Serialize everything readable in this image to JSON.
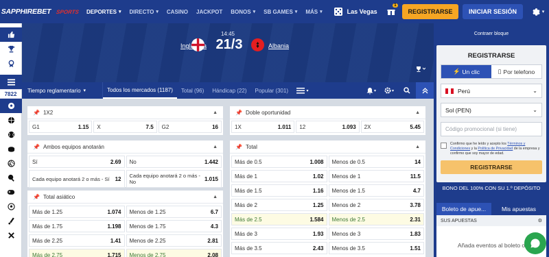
{
  "brand": {
    "name": "SAPPHIREBET",
    "promo": "SPORTS"
  },
  "nav": {
    "items": [
      {
        "label": "DEPORTES",
        "caret": true,
        "active": true
      },
      {
        "label": "DIRECTO",
        "caret": true
      },
      {
        "label": "CASINO",
        "caret": false
      },
      {
        "label": "JACKPOT",
        "caret": false
      },
      {
        "label": "BONOS",
        "caret": true
      },
      {
        "label": "SB GAMES",
        "caret": true
      },
      {
        "label": "MÁS",
        "caret": true
      }
    ],
    "lasvegas": "Las Vegas",
    "gift_badge": "1",
    "register": "REGISTRARSE",
    "login": "INICIAR SESIÓN"
  },
  "sidebar": {
    "count": "7822"
  },
  "match": {
    "time": "14:45",
    "team1": "Inglaterra",
    "team2": "Albania",
    "score": "21/3"
  },
  "tabs": {
    "period": "Tiempo reglamentario",
    "items": [
      {
        "label": "Todos los mercados (1187)",
        "active": true
      },
      {
        "label": "Total (96)"
      },
      {
        "label": "Hándicap (22)"
      },
      {
        "label": "Popular (301)"
      }
    ]
  },
  "markets": {
    "m1x2": {
      "title": "1X2",
      "odds": [
        [
          "G1",
          "1.15"
        ],
        [
          "X",
          "7.5"
        ],
        [
          "G2",
          "16"
        ]
      ]
    },
    "doble": {
      "title": "Doble oportunidad",
      "odds": [
        [
          "1X",
          "1.011"
        ],
        [
          "12",
          "1.093"
        ],
        [
          "2X",
          "5.45"
        ]
      ]
    },
    "ambos": {
      "title": "Ambos equipos anotarán",
      "rows": [
        [
          [
            "Sí",
            "2.69"
          ],
          [
            "No",
            "1.442"
          ]
        ],
        [
          [
            "Cada equipo anotará 2 o más - Sí",
            "12"
          ],
          [
            "Cada equipo anotará 2 o más - No",
            "1.015"
          ]
        ]
      ]
    },
    "total": {
      "title": "Total",
      "rows": [
        [
          [
            "Más de 0.5",
            "1.008"
          ],
          [
            "Menos de 0.5",
            "14"
          ]
        ],
        [
          [
            "Más de 1",
            "1.02"
          ],
          [
            "Menos de 1",
            "11.5"
          ]
        ],
        [
          [
            "Más de 1.5",
            "1.16"
          ],
          [
            "Menos de 1.5",
            "4.7"
          ]
        ],
        [
          [
            "Más de 2",
            "1.25"
          ],
          [
            "Menos de 2",
            "3.78"
          ]
        ],
        [
          [
            "Más de 2.5",
            "1.584"
          ],
          [
            "Menos de 2.5",
            "2.31"
          ]
        ],
        [
          [
            "Más de 3",
            "1.93"
          ],
          [
            "Menos de 3",
            "1.83"
          ]
        ],
        [
          [
            "Más de 3.5",
            "2.43"
          ],
          [
            "Menos de 3.5",
            "1.51"
          ]
        ]
      ]
    },
    "asiatico": {
      "title": "Total asiático",
      "rows": [
        [
          [
            "Más de 1.25",
            "1.074"
          ],
          [
            "Menos de 1.25",
            "6.7"
          ]
        ],
        [
          [
            "Más de 1.75",
            "1.198"
          ],
          [
            "Menos de 1.75",
            "4.3"
          ]
        ],
        [
          [
            "Más de 2.25",
            "1.41"
          ],
          [
            "Menos de 2.25",
            "2.81"
          ]
        ],
        [
          [
            "Más de 2.75",
            "1.715"
          ],
          [
            "Menos de 2.75",
            "2.08"
          ]
        ]
      ]
    }
  },
  "right": {
    "collapse": "Contraer bloque",
    "reg_title": "REGISTRARSE",
    "tab_click": "Un clic",
    "tab_phone": "Por telefono",
    "country": "Perú",
    "currency": "Sol (PEN)",
    "promo_placeholder": "Código promocional (si tiene)",
    "terms_1": "Confirmo que he leído y acepto los",
    "terms_link1": "Términos y Condiciones",
    "terms_2": "y la",
    "terms_link2": "Política de Privacidad",
    "terms_3": "de la empresa y confirmo que soy mayor de edad.",
    "register_button": "REGISTRARSE",
    "bonus": "BONO DEL 100% CON SU 1.º DEPÓSITO",
    "slip_tab1": "Boleto de apue...",
    "slip_tab2": "Mis apuestas",
    "slip_sub": "SUS APUESTAS",
    "slip_empty": "Añada eventos al boleto o"
  },
  "colors": {
    "navy": "#1e3c8c",
    "blue": "#2d52b5",
    "orange": "#f6a623",
    "green": "#2aa54f"
  }
}
